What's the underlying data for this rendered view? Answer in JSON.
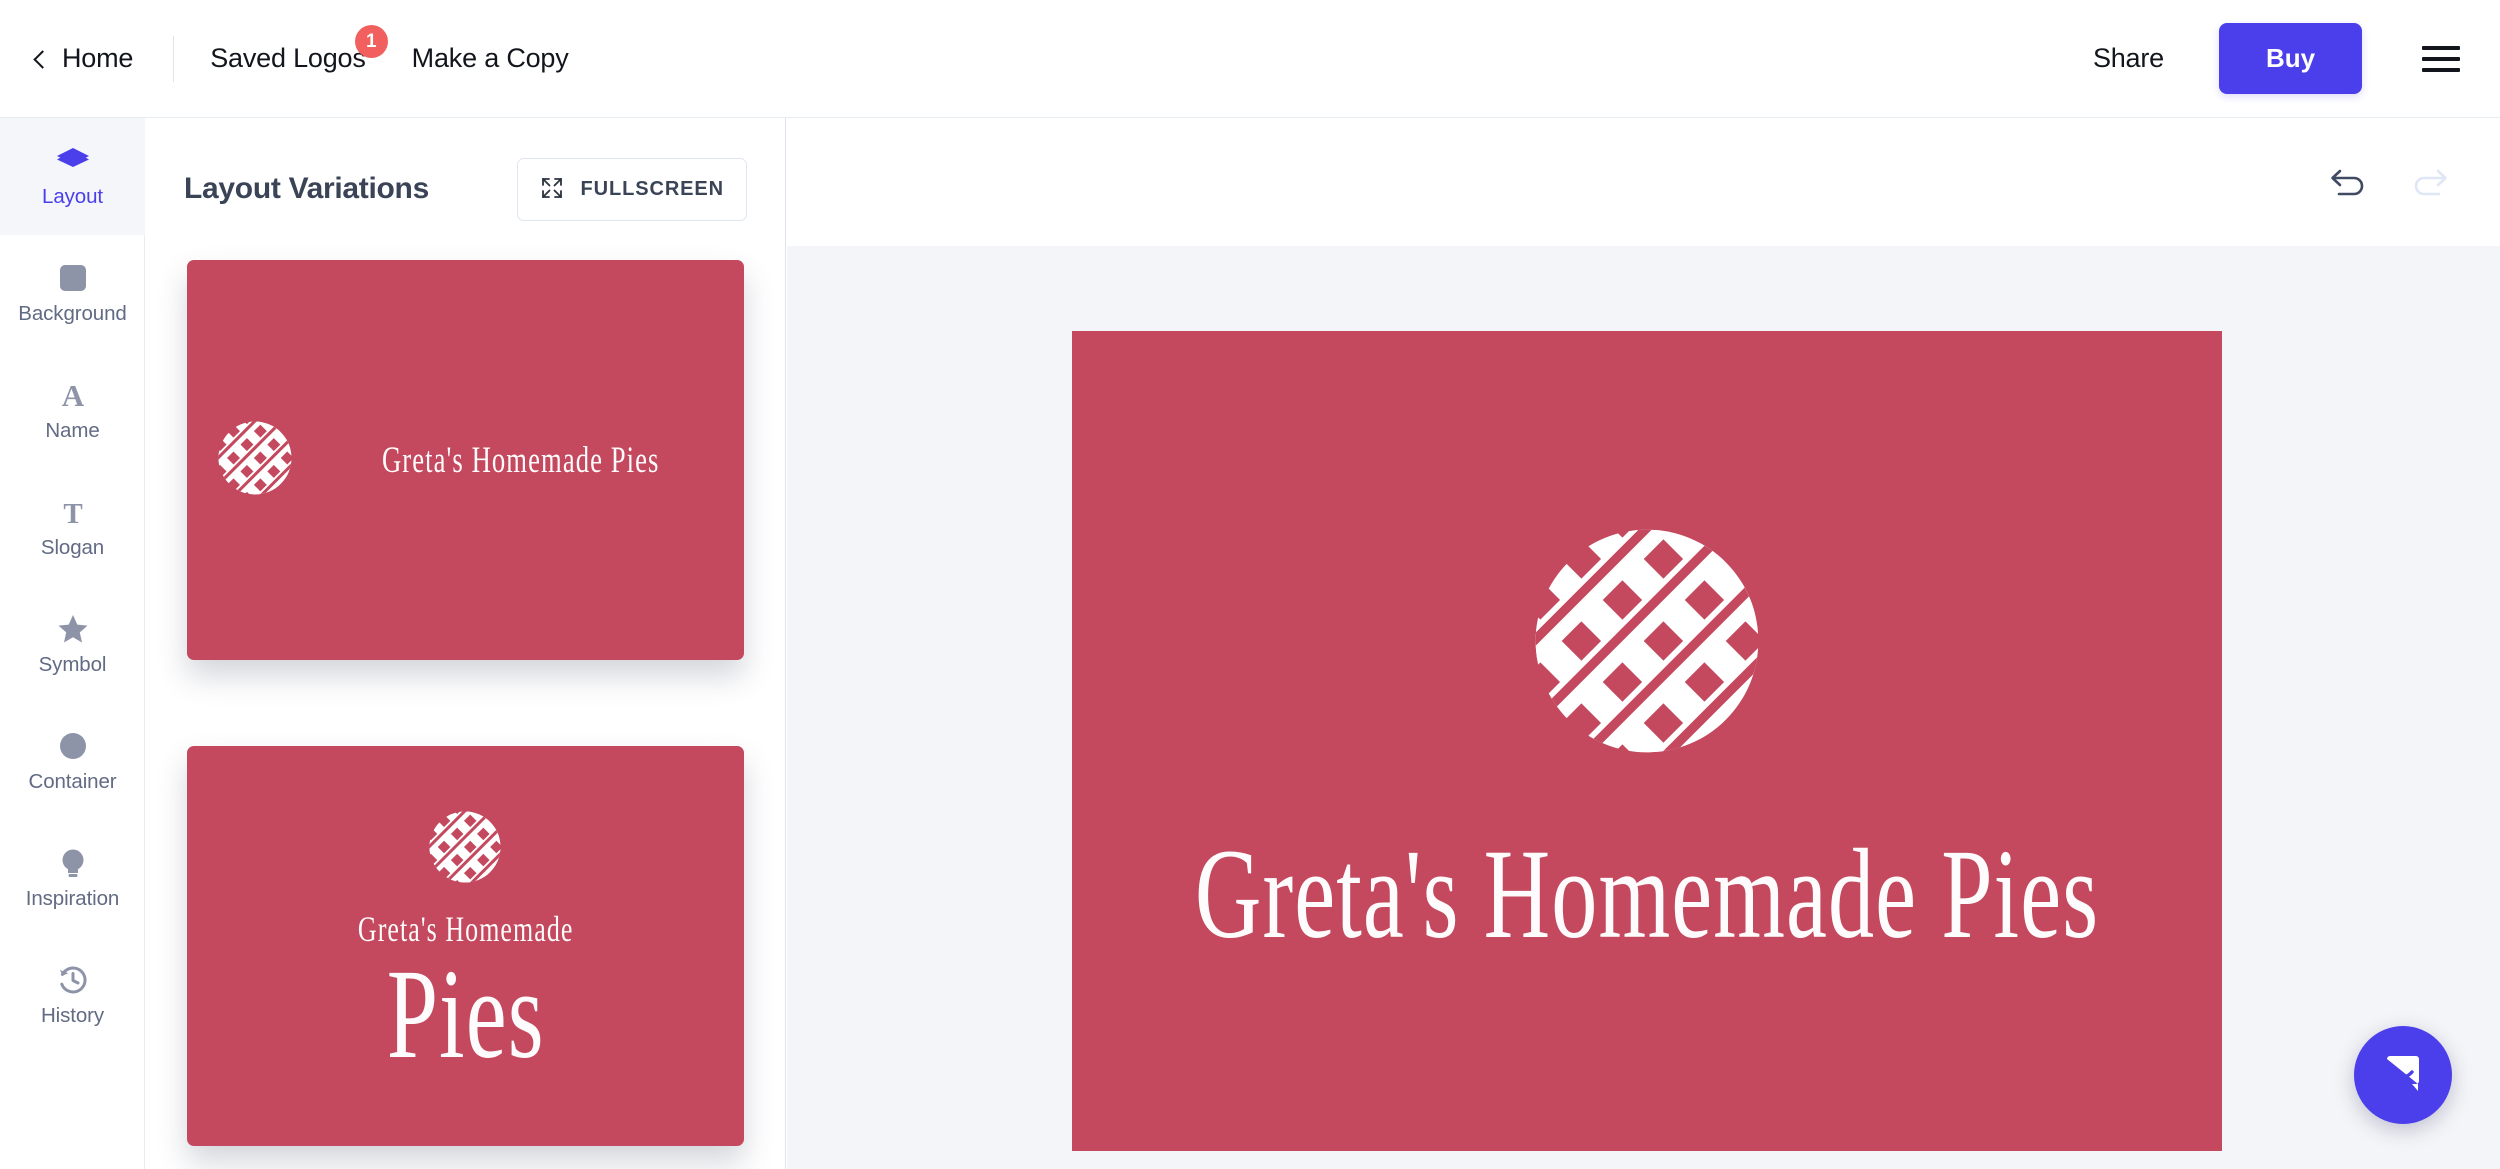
{
  "header": {
    "home_label": "Home",
    "back_icon": "chevron-left-icon",
    "saved_logos_label": "Saved Logos",
    "saved_logos_badge": "1",
    "make_copy_label": "Make a Copy",
    "share_label": "Share",
    "buy_label": "Buy",
    "menu_icon": "hamburger-menu-icon",
    "buy_color": "#4a3fea",
    "badge_color": "#f1605f"
  },
  "sidebar": {
    "active_color": "#4a3fea",
    "items": [
      {
        "label": "Layout",
        "icon": "layers-icon",
        "active": true
      },
      {
        "label": "Background",
        "icon": "square-icon",
        "active": false
      },
      {
        "label": "Name",
        "icon": "letter-a-icon",
        "active": false
      },
      {
        "label": "Slogan",
        "icon": "letter-t-icon",
        "active": false
      },
      {
        "label": "Symbol",
        "icon": "star-icon",
        "active": false
      },
      {
        "label": "Container",
        "icon": "circle-icon",
        "active": false
      },
      {
        "label": "Inspiration",
        "icon": "lightbulb-icon",
        "active": false
      },
      {
        "label": "History",
        "icon": "clock-undo-icon",
        "active": false
      }
    ]
  },
  "panel": {
    "title": "Layout Variations",
    "fullscreen_label": "FULLSCREEN",
    "fullscreen_icon": "expand-arrows-icon",
    "variations": [
      {
        "layout": "horizontal",
        "brand_line1": "Greta's Homemade Pies",
        "bg": "#c4485e"
      },
      {
        "layout": "stacked",
        "brand_line1": "Greta's Homemade",
        "brand_line2": "Pies",
        "bg": "#c4485e"
      }
    ]
  },
  "canvas": {
    "undo_icon": "undo-arrow-icon",
    "redo_icon": "redo-arrow-icon",
    "undo_enabled": true,
    "redo_enabled": false,
    "logo": {
      "background": "#c4485e",
      "symbol": "pie-lattice-icon",
      "brand_text": "Greta's Homemade Pies",
      "text_color": "#fdfbfb"
    }
  },
  "chat": {
    "icon": "chat-smile-icon",
    "color": "#4a3fea"
  }
}
